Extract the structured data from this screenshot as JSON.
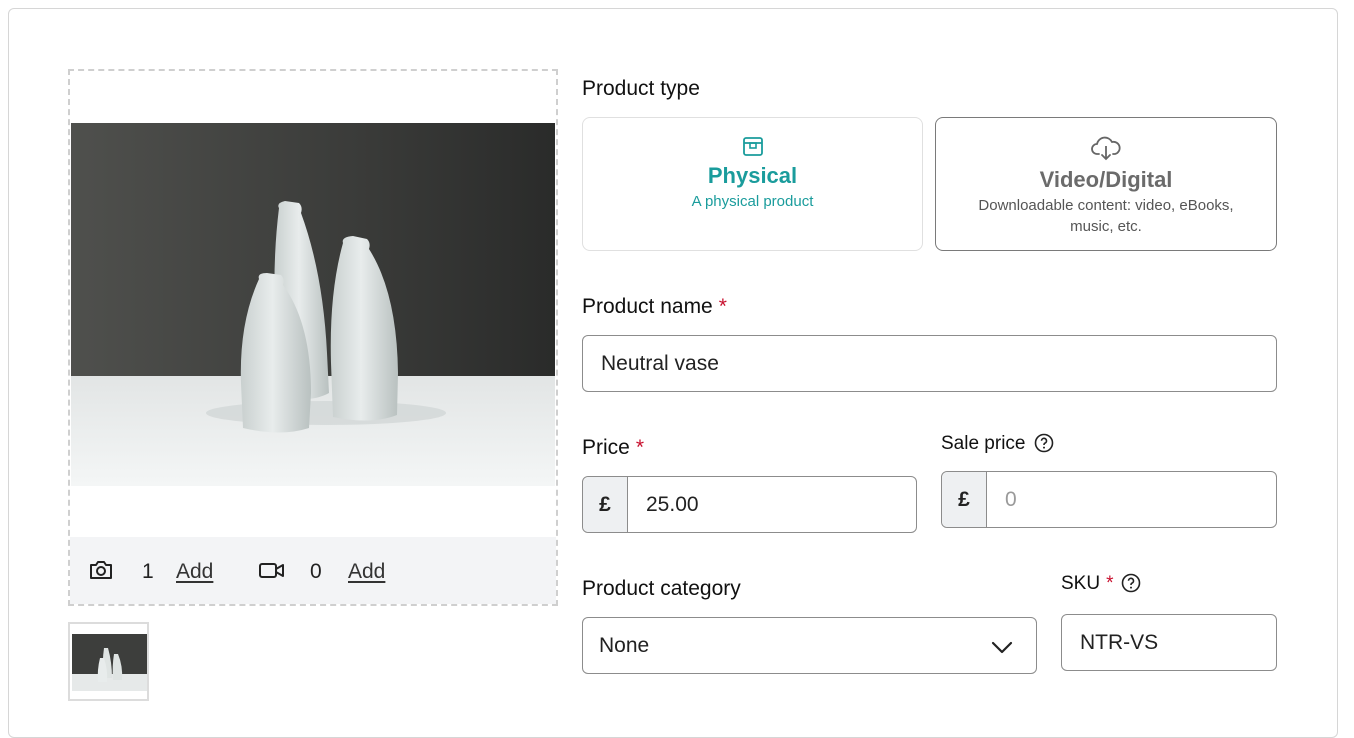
{
  "media": {
    "photo_count": "1",
    "photo_add": "Add",
    "video_count": "0",
    "video_add": "Add"
  },
  "product_type": {
    "label": "Product type",
    "options": [
      {
        "title": "Physical",
        "description": "A physical product",
        "icon": "box-icon",
        "selected": true
      },
      {
        "title": "Video/Digital",
        "description": "Downloadable content: video, eBooks, music, etc.",
        "icon": "cloud-download-icon",
        "selected": false
      }
    ]
  },
  "product_name": {
    "label": "Product name",
    "required_mark": "*",
    "value": "Neutral vase"
  },
  "price": {
    "label": "Price",
    "required_mark": "*",
    "currency": "£",
    "value": "25.00"
  },
  "sale_price": {
    "label": "Sale price",
    "currency": "£",
    "placeholder": "0"
  },
  "category": {
    "label": "Product category",
    "selected": "None"
  },
  "sku": {
    "label": "SKU",
    "required_mark": "*",
    "value": "NTR-VS"
  },
  "colors": {
    "accent": "#1a9c9c",
    "required": "#c8102e",
    "border": "#8c8c8c"
  }
}
